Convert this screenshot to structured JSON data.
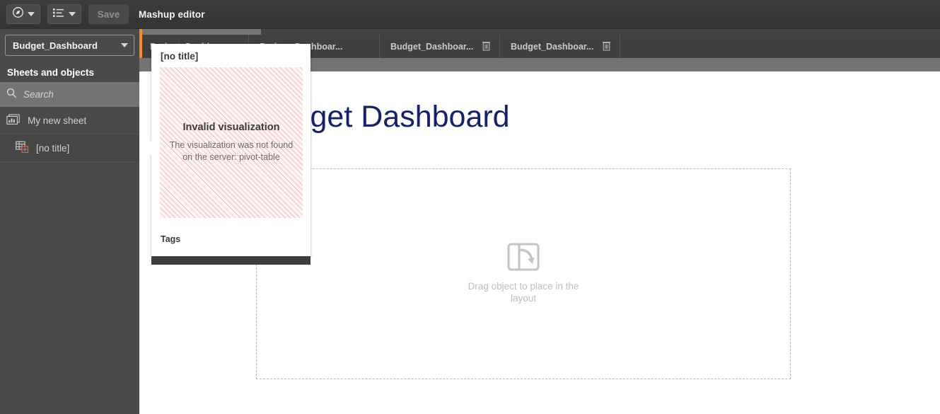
{
  "toolbar": {
    "nav_icon": "compass-icon",
    "list_icon": "list-icon",
    "save_label": "Save",
    "app_title": "Mashup editor"
  },
  "sidebar": {
    "app_selector": {
      "label": "Budget_Dashboard",
      "caret_icon": "chevron-down-icon"
    },
    "heading": "Sheets and objects",
    "search": {
      "placeholder": "Search",
      "value": "",
      "icon": "search-icon"
    },
    "items": [
      {
        "label": "My new sheet",
        "icon": "sheet-icon"
      },
      {
        "label": "[no title]",
        "icon": "table-add-icon"
      }
    ]
  },
  "tabstrip": {
    "tabs": [
      {
        "label": "Budget_Dashboar...",
        "delete_icon": "trash-icon"
      },
      {
        "label": "Budget_Dashboar...",
        "delete_icon": "trash-icon"
      },
      {
        "label": "Budget_Dashboar...",
        "delete_icon": "trash-icon"
      },
      {
        "label": "Budget_Dashboar...",
        "delete_icon": "trash-icon"
      }
    ]
  },
  "canvas": {
    "title": "Budget Dashboard",
    "dropzone": {
      "label": "Drag object to place in the layout",
      "icon": "drag-object-icon"
    }
  },
  "popup": {
    "title": "[no title]",
    "invalid_heading": "Invalid visualization",
    "invalid_message": "The visualization was not found on the server: pivot-table",
    "tags_label": "Tags"
  },
  "colors": {
    "accent_orange": "#ff8a1c",
    "toolbar_dark": "#3a3a3a",
    "tabbar": "#404040",
    "sidebar": "#4a4a4a",
    "grey_band": "#737373",
    "title_blue": "#16216b",
    "invalid_stripe": "#f3bdbd"
  }
}
